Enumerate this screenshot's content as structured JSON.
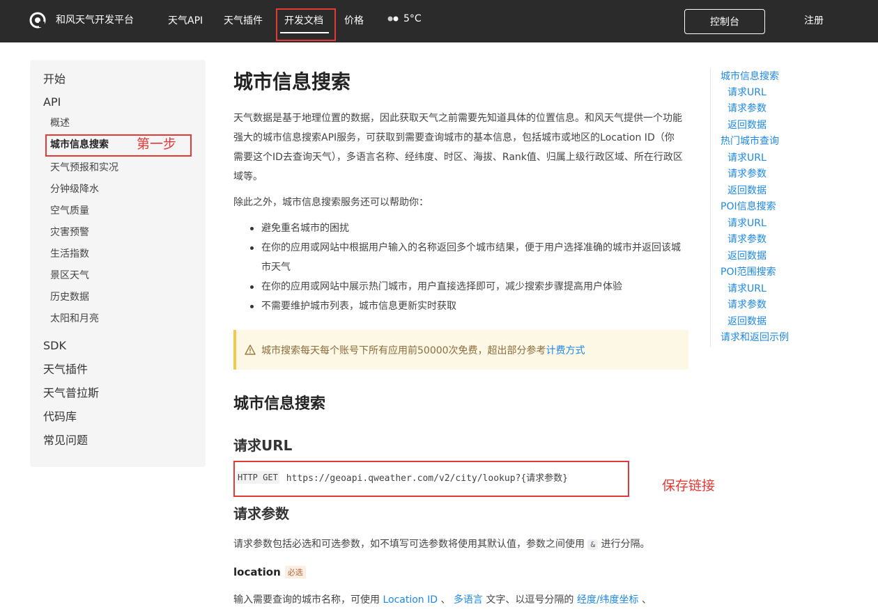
{
  "topbar": {
    "brand": "和风天气开发平台",
    "nav": [
      "天气API",
      "天气插件",
      "开发文档",
      "价格"
    ],
    "weather": "5°C",
    "console_button": "控制台",
    "register_link": "注册"
  },
  "sidebar": {
    "top1": "开始",
    "top2": "API",
    "api_items": [
      "概述",
      "城市信息搜索",
      "天气预报和实况",
      "分钟级降水",
      "空气质量",
      "灾害预警",
      "生活指数",
      "景区天气",
      "历史数据",
      "太阳和月亮"
    ],
    "bottom_items": [
      "SDK",
      "天气插件",
      "天气普拉斯",
      "代码库",
      "常见问题"
    ],
    "step_note": "第一步"
  },
  "main": {
    "title": "城市信息搜索",
    "intro": "天气数据是基于地理位置的数据，因此获取天气之前需要先知道具体的位置信息。和风天气提供一个功能强大的城市信息搜索API服务，可获取到需要查询城市的基本信息，包括城市或地区的Location ID（你需要这个ID去查询天气），多语言名称、经纬度、时区、海拔、Rank值、归属上级行政区域、所在行政区域等。",
    "also": "除此之外，城市信息搜索服务还可以帮助你：",
    "bullets": [
      "避免重名城市的困扰",
      "在你的应用或网站中根据用户输入的名称返回多个城市结果，便于用户选择准确的城市并返回该城市天气",
      "在你的应用或网站中展示热门城市，用户直接选择即可，减少搜索步骤提高用户体验",
      "不需要维护城市列表，城市信息更新实时获取"
    ],
    "notice_text": "城市搜索每天每个账号下所有应用前50000次免费，超出部分参考",
    "notice_link": "计费方式",
    "section_title": "城市信息搜索",
    "request_url_title": "请求URL",
    "http_method": "HTTP GET",
    "url": "https://geoapi.qweather.com/v2/city/lookup?{请求参数}",
    "save_note": "保存链接",
    "request_params_title": "请求参数",
    "params_desc_before": "请求参数包括必选和可选参数，如不填写可选参数将使用其默认值，参数之间使用",
    "params_separator": "&",
    "params_desc_after": "进行分隔。",
    "param_location": "location",
    "param_required": "必选",
    "location_desc_before": "输入需要查询的城市名称，可使用",
    "location_link1": "Location ID",
    "location_sep1": "、",
    "location_link2": "多语言",
    "location_mid": "文字、以逗号分隔的",
    "location_link3": "经度/纬度坐标",
    "location_end": "、"
  },
  "toc": {
    "items": [
      "城市信息搜索",
      "请求URL",
      "请求参数",
      "返回数据",
      "热门城市查询",
      "请求URL",
      "请求参数",
      "返回数据",
      "POI信息搜索",
      "请求URL",
      "请求参数",
      "返回数据",
      "POI范围搜索",
      "请求URL",
      "请求参数",
      "返回数据",
      "请求和返回示例"
    ]
  },
  "colors": {
    "topbar_bg": "#2b2b2b",
    "annotation_red": "#e53935",
    "link_blue": "#1e88e5",
    "notice_bg": "#fdf7e6"
  },
  "icons": [
    "qweather-logo-icon",
    "weather-moon-icon",
    "warning-icon"
  ]
}
